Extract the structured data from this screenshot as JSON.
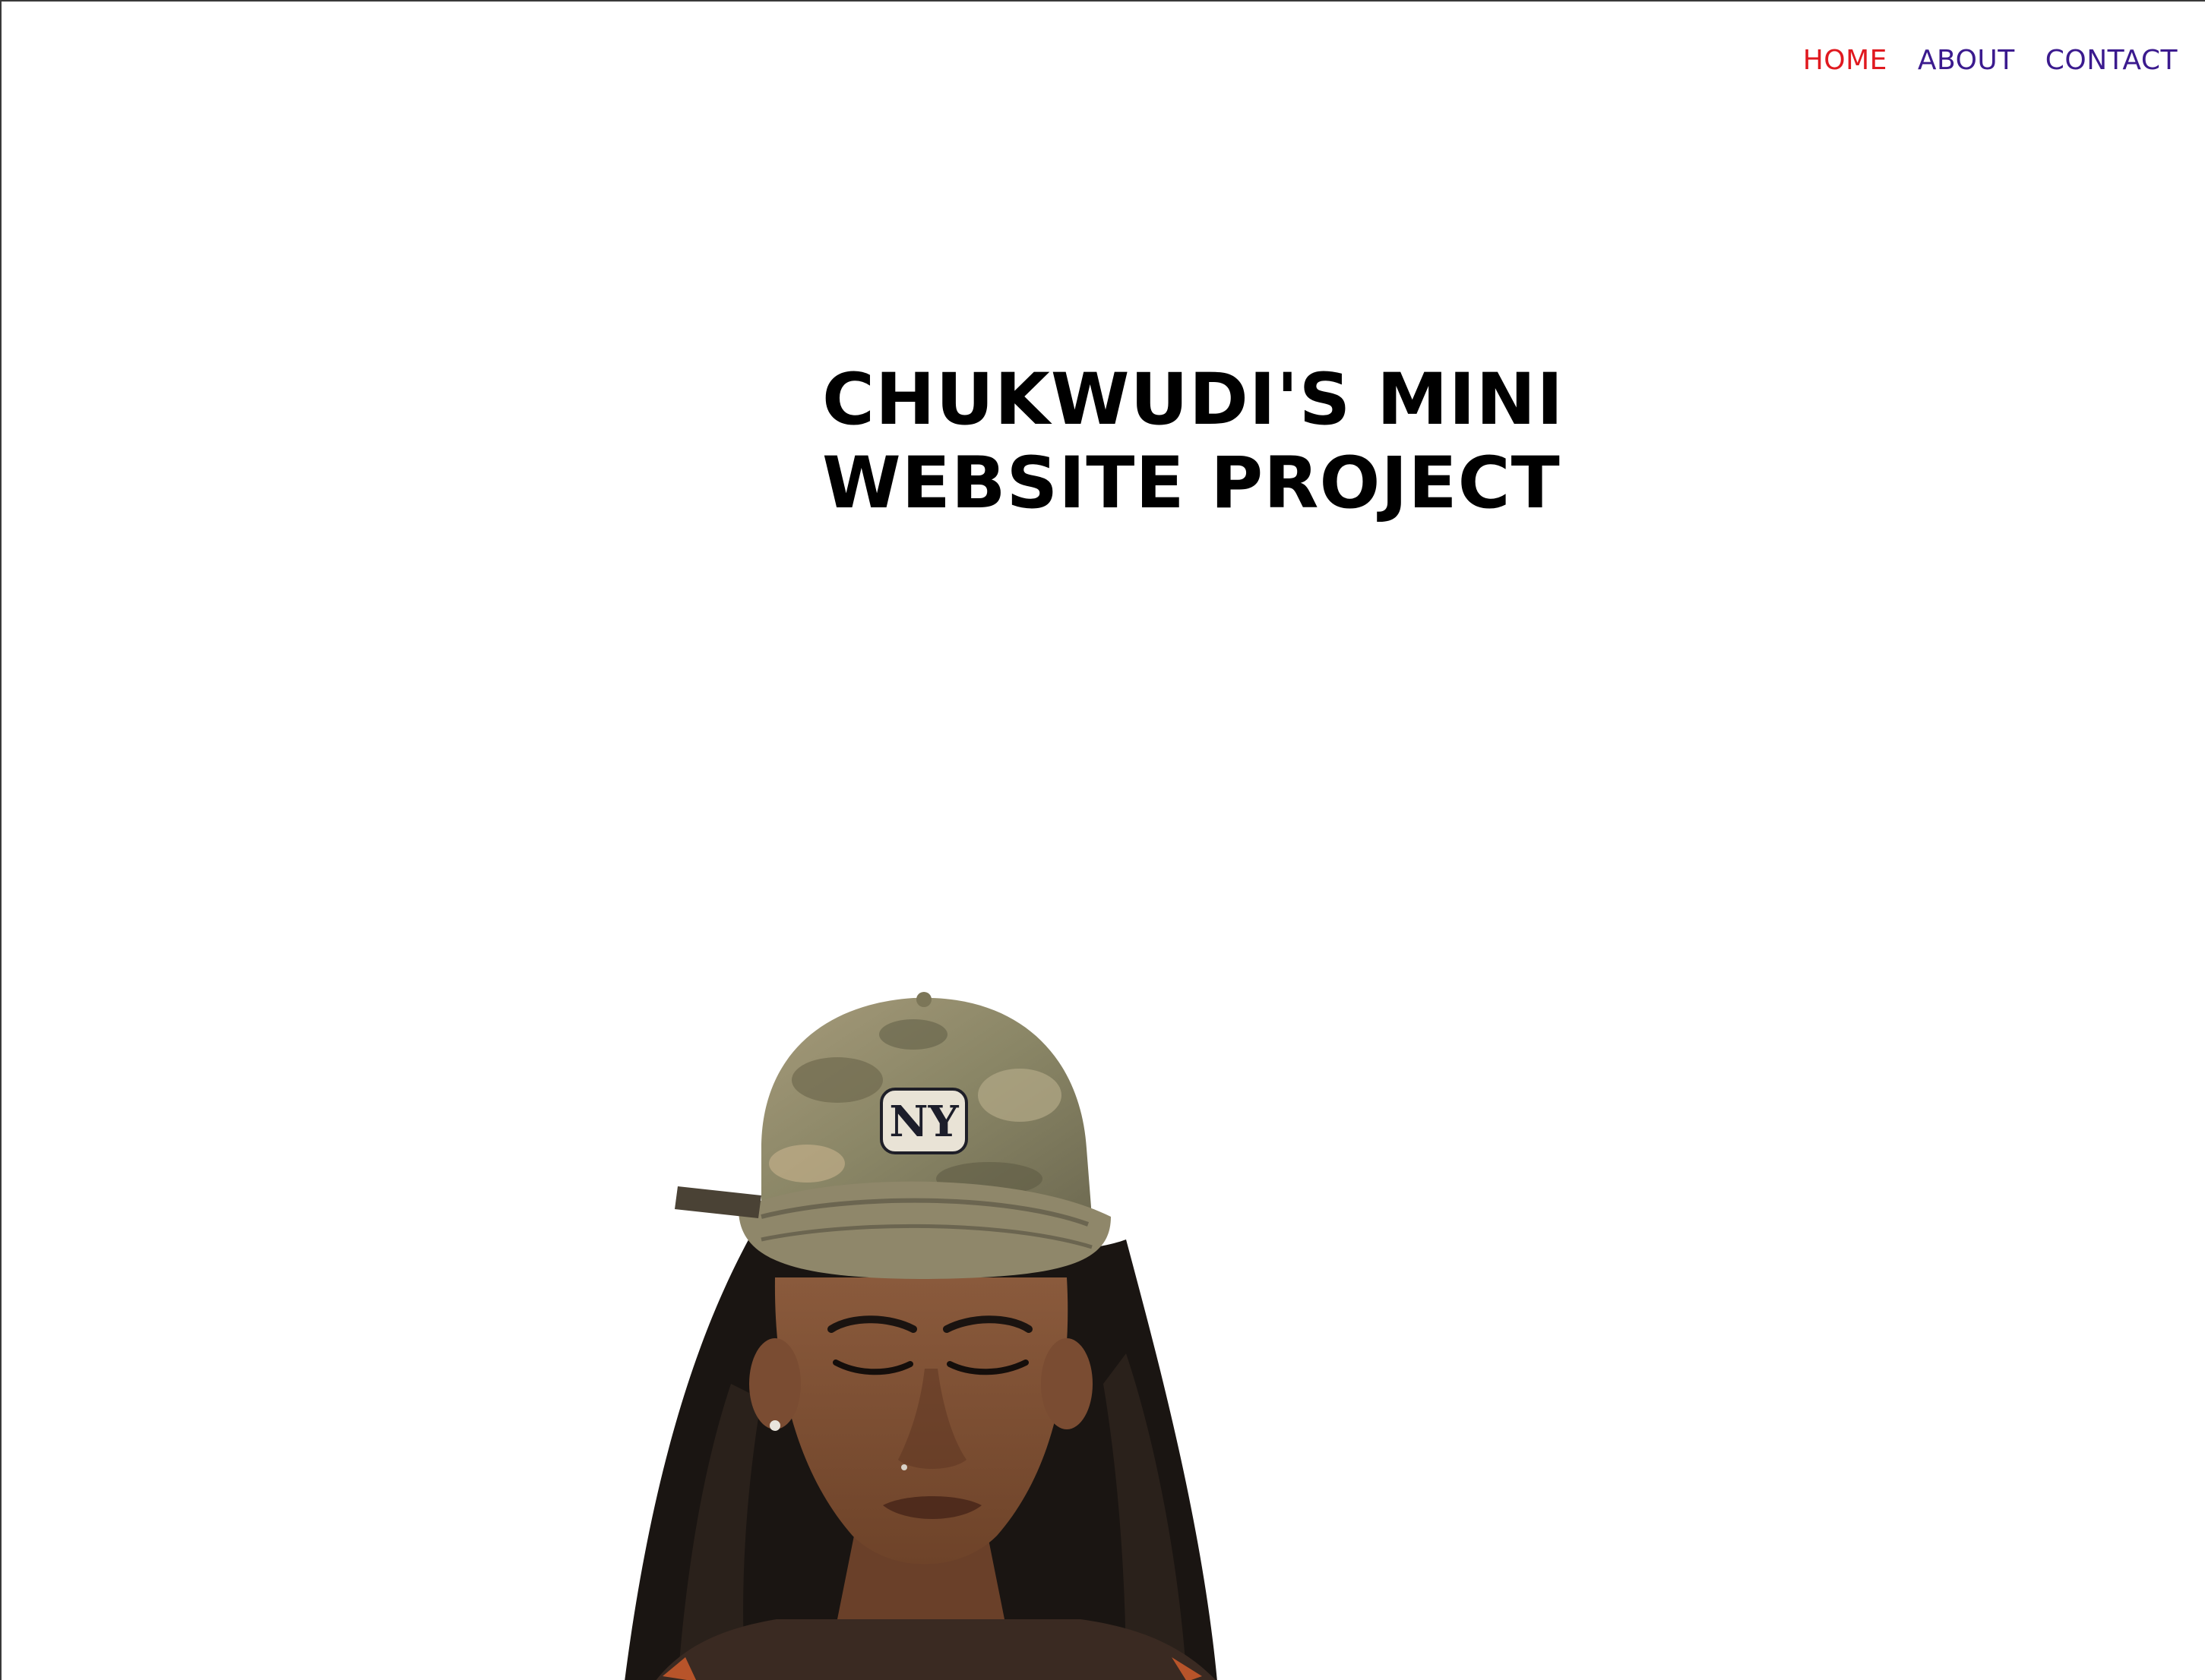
{
  "nav": {
    "items": [
      {
        "label": "HOME",
        "color": "#e0191f"
      },
      {
        "label": "ABOUT",
        "color": "#3b1a8e"
      },
      {
        "label": "CONTACT",
        "color": "#3b1a8e"
      }
    ]
  },
  "hero": {
    "title_line1": "CHUKWUDI'S MINI",
    "title_line2": "WEBSITE PROJECT"
  },
  "image": {
    "cap_logo": "NY"
  }
}
